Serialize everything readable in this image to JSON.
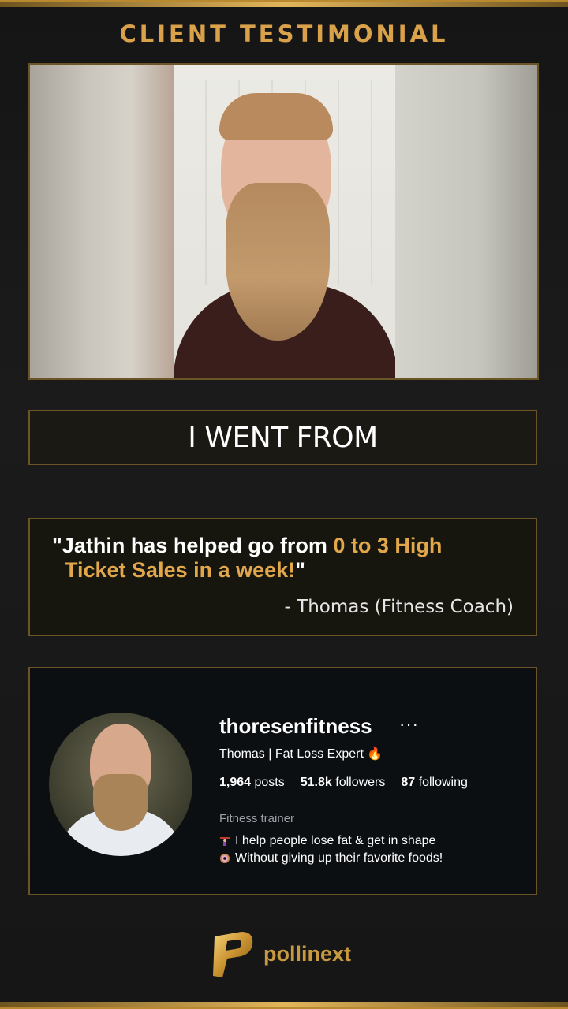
{
  "header": {
    "title": "CLIENT TESTIMONIAL"
  },
  "banner": {
    "text": "I WENT FROM"
  },
  "quote": {
    "open": "\"Jathin has helped go from ",
    "highlight1": "0 to 3 High",
    "highlight2": "Ticket Sales in a week!",
    "close": "\"",
    "author": "- Thomas (Fitness Coach)"
  },
  "profile": {
    "username": "thoresenfitness",
    "more": "···",
    "name": "Thomas | Fat Loss Expert 🔥",
    "stats": {
      "posts_value": "1,964",
      "posts_label": "posts",
      "followers_value": "51.8k",
      "followers_label": "followers",
      "following_value": "87",
      "following_label": "following"
    },
    "category": "Fitness trainer",
    "bio_line1": "I help people lose fat & get in shape",
    "bio_line2": "Without giving up their favorite foods!"
  },
  "logo": {
    "text": "pollinext"
  },
  "colors": {
    "gold": "#d9a24a",
    "highlight": "#e3a74b",
    "border": "#6b5426"
  }
}
